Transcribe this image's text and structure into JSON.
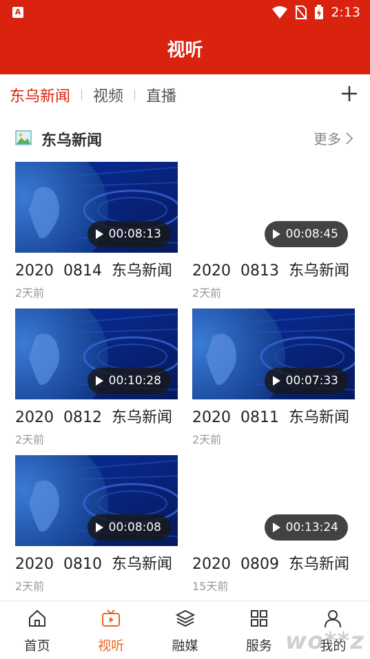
{
  "status_bar": {
    "app_badge": "A",
    "time": "2:13"
  },
  "header": {
    "title": "视听"
  },
  "tabs": [
    {
      "label": "东乌新闻",
      "active": true
    },
    {
      "label": "视频",
      "active": false
    },
    {
      "label": "直播",
      "active": false
    }
  ],
  "section": {
    "title": "东乌新闻",
    "more_label": "更多"
  },
  "videos": [
    {
      "title": "2020  0814  东乌新闻",
      "time_ago": "2天前",
      "duration": "00:08:13",
      "thumbnail": true
    },
    {
      "title": "2020  0813  东乌新闻",
      "time_ago": "2天前",
      "duration": "00:08:45",
      "thumbnail": false
    },
    {
      "title": "2020  0812  东乌新闻",
      "time_ago": "2天前",
      "duration": "00:10:28",
      "thumbnail": true
    },
    {
      "title": "2020  0811  东乌新闻",
      "time_ago": "2天前",
      "duration": "00:07:33",
      "thumbnail": true
    },
    {
      "title": "2020  0810  东乌新闻",
      "time_ago": "2天前",
      "duration": "00:08:08",
      "thumbnail": true
    },
    {
      "title": "2020  0809  东乌新闻",
      "time_ago": "15天前",
      "duration": "00:13:24",
      "thumbnail": false
    }
  ],
  "bottom_nav": [
    {
      "label": "首页",
      "icon": "home-icon",
      "active": false
    },
    {
      "label": "视听",
      "icon": "tv-icon",
      "active": true
    },
    {
      "label": "融媒",
      "icon": "layers-icon",
      "active": false
    },
    {
      "label": "服务",
      "icon": "grid-icon",
      "active": false
    },
    {
      "label": "我的",
      "icon": "user-icon",
      "active": false
    }
  ],
  "watermark": "wo**z",
  "colors": {
    "brand_red": "#d9230f",
    "active_orange": "#e8661c"
  }
}
